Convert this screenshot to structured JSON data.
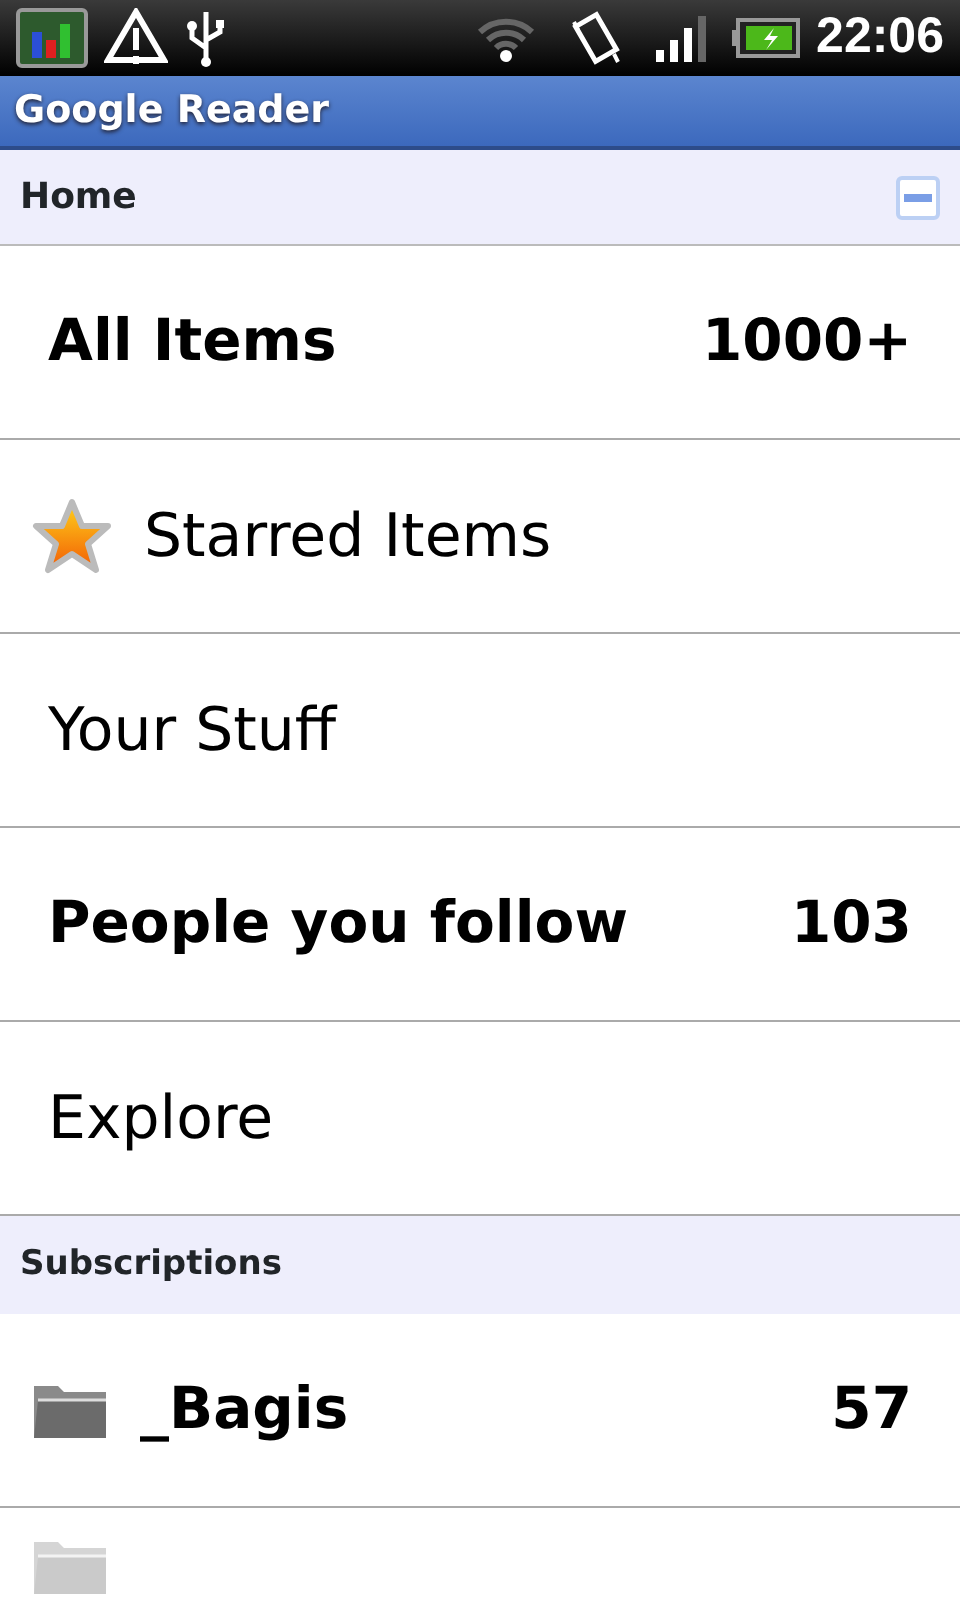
{
  "status_bar": {
    "time": "22:06"
  },
  "window": {
    "title": "Google Reader"
  },
  "sections": [
    {
      "title": "Home",
      "expanded": true,
      "items": [
        {
          "label": "All Items",
          "count": "1000+",
          "unread": true
        },
        {
          "label": "Starred Items",
          "kind": "starred",
          "unread": false
        },
        {
          "label": "Your Stuff",
          "unread": false
        },
        {
          "label": "People you follow",
          "count": "103",
          "unread": true
        },
        {
          "label": "Explore",
          "unread": false
        }
      ]
    },
    {
      "title": "Subscriptions",
      "items": [
        {
          "label": "_Bagis",
          "count": "57",
          "kind": "folder",
          "unread": true
        }
      ]
    }
  ],
  "partial_row": {
    "kind": "folder"
  }
}
